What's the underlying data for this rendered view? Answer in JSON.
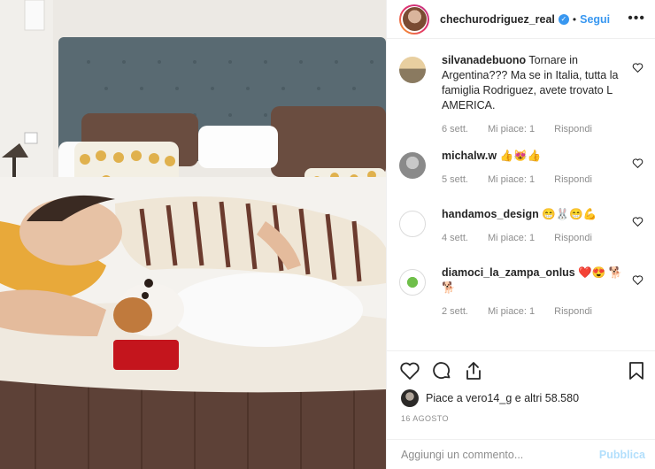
{
  "post": {
    "author": "chechurodriguez_real",
    "separator": "•",
    "follow_label": "Segui",
    "more_label": "•••"
  },
  "comments": [
    {
      "user": "silvanadebuono",
      "text": "Tornare in Argentina??? Ma se in Italia, tutta la famiglia Rodriguez, avete trovato L AMERICA.",
      "time": "6 sett.",
      "likes": "Mi piace: 1",
      "reply": "Rispondi"
    },
    {
      "user": "michalw.w",
      "text": "👍😻👍",
      "time": "5 sett.",
      "likes": "Mi piace: 1",
      "reply": "Rispondi"
    },
    {
      "user": "handamos_design",
      "text": "😁🐰😁💪",
      "time": "4 sett.",
      "likes": "Mi piace: 1",
      "reply": "Rispondi"
    },
    {
      "user": "diamoci_la_zampa_onlus",
      "text": "❤️😍 🐕🐕",
      "time": "2 sett.",
      "likes": "Mi piace: 1",
      "reply": "Rispondi"
    }
  ],
  "likes_text": "Piace a vero14_g e altri 58.580",
  "date": "16 AGOSTO",
  "add_comment": {
    "placeholder": "Aggiungi un commento...",
    "publish_label": "Pubblica"
  },
  "icons": [
    "verified-icon",
    "more-icon",
    "heart-icon",
    "comment-icon",
    "share-icon",
    "bookmark-icon"
  ],
  "colors": {
    "link": "#3897f0",
    "muted": "#8e8e8e",
    "publish_disabled": "#b2dffc",
    "text": "#262626"
  }
}
